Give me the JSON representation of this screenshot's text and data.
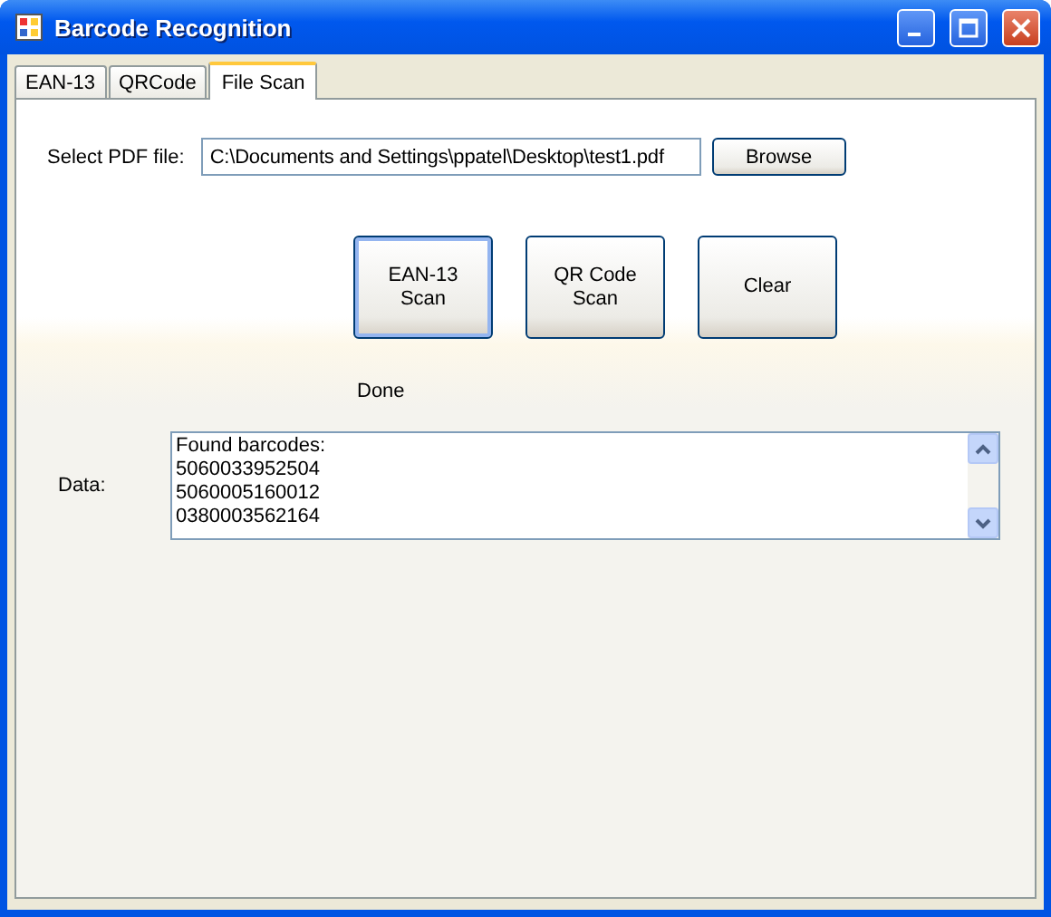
{
  "window": {
    "title": "Barcode Recognition"
  },
  "tabs": [
    {
      "label": "EAN-13",
      "selected": false
    },
    {
      "label": "QRCode",
      "selected": false
    },
    {
      "label": "File Scan",
      "selected": true
    }
  ],
  "file_row": {
    "label": "Select PDF file:",
    "value": "C:\\Documents and Settings\\ppatel\\Desktop\\test1.pdf",
    "button": "Browse"
  },
  "buttons": [
    {
      "label": "EAN-13\nScan",
      "focused": true
    },
    {
      "label": "QR Code\nScan",
      "focused": false
    },
    {
      "label": "Clear",
      "focused": false
    }
  ],
  "status": "Done",
  "data": {
    "label": "Data:",
    "lines": [
      "Found barcodes:",
      "5060033952504",
      "5060005160012",
      "0380003562164"
    ]
  }
}
